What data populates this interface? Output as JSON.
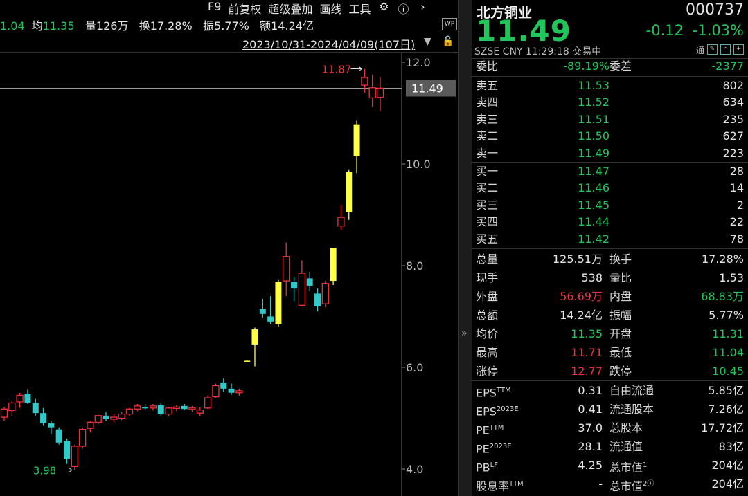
{
  "toolbar": {
    "f9": "F9",
    "adjust": "前复权",
    "overlay": "超级叠加",
    "draw": "画线",
    "tools": "工具",
    "settings_icon": "gear-icon",
    "help_icon": "help-icon",
    "more_icon": "chevron-right-icon"
  },
  "stats": {
    "partial_val": "1.04",
    "avg_label": "均",
    "avg_val": "11.35",
    "vol_label": "量",
    "vol_val": "126万",
    "turn_label": "换",
    "turn_val": "17.28%",
    "amp_label": "振",
    "amp_val": "5.77%",
    "amt_label": "额",
    "amt_val": "14.24亿"
  },
  "date_range": "2023/10/31-2024/04/09(107日)",
  "wp_label": "WP",
  "chart_data": {
    "type": "candlestick",
    "y_ticks": [
      "12.0",
      "10.0",
      "8.0",
      "6.0",
      "4.0"
    ],
    "y_tick_values": [
      12.0,
      10.0,
      8.0,
      6.0,
      4.0
    ],
    "ylim": [
      3.85,
      12.45
    ],
    "current_price_label": "11.49",
    "current_price": 11.49,
    "max_label": "11.87",
    "max_value": 11.87,
    "min_label": "3.98",
    "min_value": 3.98,
    "colors": {
      "up": "#f0313b",
      "down": "#32c8c8",
      "limit_up": "#ffff44"
    },
    "candles": [
      {
        "o": 5.02,
        "h": 5.22,
        "l": 4.95,
        "c": 5.18,
        "t": "up"
      },
      {
        "o": 5.15,
        "h": 5.35,
        "l": 5.05,
        "c": 5.3,
        "t": "up"
      },
      {
        "o": 5.32,
        "h": 5.5,
        "l": 5.2,
        "c": 5.45,
        "t": "up"
      },
      {
        "o": 5.48,
        "h": 5.56,
        "l": 5.28,
        "c": 5.3,
        "t": "down"
      },
      {
        "o": 5.3,
        "h": 5.38,
        "l": 5.05,
        "c": 5.1,
        "t": "down"
      },
      {
        "o": 5.1,
        "h": 5.2,
        "l": 4.85,
        "c": 4.9,
        "t": "down"
      },
      {
        "o": 4.9,
        "h": 4.95,
        "l": 4.68,
        "c": 4.82,
        "t": "down"
      },
      {
        "o": 4.78,
        "h": 4.82,
        "l": 4.48,
        "c": 4.52,
        "t": "down"
      },
      {
        "o": 4.55,
        "h": 4.6,
        "l": 4.1,
        "c": 4.2,
        "t": "down"
      },
      {
        "o": 4.05,
        "h": 4.48,
        "l": 3.98,
        "c": 4.45,
        "t": "up"
      },
      {
        "o": 4.45,
        "h": 4.82,
        "l": 4.4,
        "c": 4.78,
        "t": "up"
      },
      {
        "o": 4.8,
        "h": 4.95,
        "l": 4.72,
        "c": 4.92,
        "t": "up"
      },
      {
        "o": 4.92,
        "h": 5.08,
        "l": 4.88,
        "c": 5.05,
        "t": "up"
      },
      {
        "o": 5.05,
        "h": 5.12,
        "l": 4.95,
        "c": 4.98,
        "t": "down"
      },
      {
        "o": 4.98,
        "h": 5.08,
        "l": 4.92,
        "c": 5.02,
        "t": "up"
      },
      {
        "o": 5.0,
        "h": 5.12,
        "l": 4.96,
        "c": 5.08,
        "t": "up"
      },
      {
        "o": 5.08,
        "h": 5.2,
        "l": 5.04,
        "c": 5.18,
        "t": "up"
      },
      {
        "o": 5.18,
        "h": 5.28,
        "l": 5.14,
        "c": 5.24,
        "t": "up"
      },
      {
        "o": 5.22,
        "h": 5.28,
        "l": 5.16,
        "c": 5.2,
        "t": "down"
      },
      {
        "o": 5.2,
        "h": 5.28,
        "l": 5.15,
        "c": 5.24,
        "t": "up"
      },
      {
        "o": 5.26,
        "h": 5.3,
        "l": 5.05,
        "c": 5.08,
        "t": "down"
      },
      {
        "o": 5.08,
        "h": 5.22,
        "l": 5.04,
        "c": 5.2,
        "t": "up"
      },
      {
        "o": 5.2,
        "h": 5.26,
        "l": 5.14,
        "c": 5.22,
        "t": "up"
      },
      {
        "o": 5.24,
        "h": 5.28,
        "l": 5.16,
        "c": 5.18,
        "t": "down"
      },
      {
        "o": 5.18,
        "h": 5.24,
        "l": 5.12,
        "c": 5.2,
        "t": "up"
      },
      {
        "o": 5.1,
        "h": 5.22,
        "l": 5.04,
        "c": 5.16,
        "t": "up"
      },
      {
        "o": 5.2,
        "h": 5.45,
        "l": 5.18,
        "c": 5.4,
        "t": "up"
      },
      {
        "o": 5.42,
        "h": 5.68,
        "l": 5.4,
        "c": 5.64,
        "t": "up"
      },
      {
        "o": 5.7,
        "h": 5.78,
        "l": 5.52,
        "c": 5.58,
        "t": "down"
      },
      {
        "o": 5.58,
        "h": 5.68,
        "l": 5.46,
        "c": 5.5,
        "t": "down"
      },
      {
        "o": 5.5,
        "h": 5.58,
        "l": 5.44,
        "c": 5.54,
        "t": "up"
      },
      {
        "o": 6.12,
        "h": 6.14,
        "l": 6.1,
        "c": 6.13,
        "t": "limit"
      },
      {
        "o": 6.45,
        "h": 6.78,
        "l": 6.02,
        "c": 6.75,
        "t": "limit"
      },
      {
        "o": 7.15,
        "h": 7.35,
        "l": 6.98,
        "c": 7.05,
        "t": "down"
      },
      {
        "o": 7.0,
        "h": 7.4,
        "l": 6.85,
        "c": 6.9,
        "t": "down"
      },
      {
        "o": 6.85,
        "h": 7.72,
        "l": 6.8,
        "c": 7.68,
        "t": "limit"
      },
      {
        "o": 7.7,
        "h": 8.45,
        "l": 7.4,
        "c": 8.18,
        "t": "up"
      },
      {
        "o": 7.68,
        "h": 7.78,
        "l": 7.3,
        "c": 7.55,
        "t": "down"
      },
      {
        "o": 7.22,
        "h": 8.1,
        "l": 7.2,
        "c": 7.85,
        "t": "up"
      },
      {
        "o": 7.75,
        "h": 7.88,
        "l": 7.5,
        "c": 7.6,
        "t": "down"
      },
      {
        "o": 7.45,
        "h": 7.55,
        "l": 7.1,
        "c": 7.2,
        "t": "down"
      },
      {
        "o": 7.25,
        "h": 7.7,
        "l": 7.18,
        "c": 7.65,
        "t": "up"
      },
      {
        "o": 7.7,
        "h": 8.35,
        "l": 7.62,
        "c": 8.35,
        "t": "limit"
      },
      {
        "o": 8.78,
        "h": 9.2,
        "l": 8.7,
        "c": 8.95,
        "t": "up"
      },
      {
        "o": 9.05,
        "h": 9.88,
        "l": 8.9,
        "c": 9.85,
        "t": "limit"
      },
      {
        "o": 10.15,
        "h": 10.85,
        "l": 9.82,
        "c": 10.78,
        "t": "limit"
      },
      {
        "o": 11.7,
        "h": 11.87,
        "l": 11.4,
        "c": 11.55,
        "t": "up"
      },
      {
        "o": 11.5,
        "h": 11.75,
        "l": 11.12,
        "c": 11.3,
        "t": "up"
      },
      {
        "o": 11.31,
        "h": 11.71,
        "l": 11.04,
        "c": 11.49,
        "t": "up"
      }
    ]
  },
  "quote": {
    "name": "北方铜业",
    "code": "000737",
    "price": "11.49",
    "change": "-0.12",
    "change_pct": "-1.03%",
    "exchange": "SZSE",
    "currency": "CNY",
    "time": "11:29:18",
    "status": "交易中",
    "tong": "通",
    "ratio_label": "委比",
    "ratio_val": "-89.19%",
    "diff_label": "委差",
    "diff_val": "-2377",
    "asks": [
      {
        "label": "卖五",
        "price": "11.53",
        "vol": "802"
      },
      {
        "label": "卖四",
        "price": "11.52",
        "vol": "634"
      },
      {
        "label": "卖三",
        "price": "11.51",
        "vol": "235"
      },
      {
        "label": "卖二",
        "price": "11.50",
        "vol": "627"
      },
      {
        "label": "卖一",
        "price": "11.49",
        "vol": "223"
      }
    ],
    "bids": [
      {
        "label": "买一",
        "price": "11.47",
        "vol": "28"
      },
      {
        "label": "买二",
        "price": "11.46",
        "vol": "14"
      },
      {
        "label": "买三",
        "price": "11.45",
        "vol": "2"
      },
      {
        "label": "买四",
        "price": "11.44",
        "vol": "22"
      },
      {
        "label": "买五",
        "price": "11.42",
        "vol": "78"
      }
    ],
    "stats": [
      {
        "k1": "总量",
        "v1": "125.51万",
        "c1": "wht",
        "k2": "换手",
        "v2": "17.28%",
        "c2": "wht"
      },
      {
        "k1": "现手",
        "v1": "538",
        "c1": "wht",
        "k2": "量比",
        "v2": "1.53",
        "c2": "wht"
      },
      {
        "k1": "外盘",
        "v1": "56.69万",
        "c1": "red",
        "k2": "内盘",
        "v2": "68.83万",
        "c2": "grn"
      },
      {
        "k1": "总额",
        "v1": "14.24亿",
        "c1": "wht",
        "k2": "振幅",
        "v2": "5.77%",
        "c2": "wht"
      },
      {
        "k1": "均价",
        "v1": "11.35",
        "c1": "grn",
        "k2": "开盘",
        "v2": "11.31",
        "c2": "grn"
      },
      {
        "k1": "最高",
        "v1": "11.71",
        "c1": "red",
        "k2": "最低",
        "v2": "11.04",
        "c2": "grn"
      },
      {
        "k1": "涨停",
        "v1": "12.77",
        "c1": "red",
        "k2": "跌停",
        "v2": "10.45",
        "c2": "grn"
      }
    ],
    "fundamentals": [
      {
        "k1": "EPS",
        "s1": "TTM",
        "v1": "0.31",
        "k2": "自由流通",
        "s2": "",
        "v2": "5.85亿"
      },
      {
        "k1": "EPS",
        "s1": "2023E",
        "v1": "0.41",
        "k2": "流通股本",
        "s2": "",
        "v2": "7.26亿"
      },
      {
        "k1": "PE",
        "s1": "TTM",
        "v1": "37.0",
        "k2": "总股本",
        "s2": "",
        "v2": "17.72亿"
      },
      {
        "k1": "PE",
        "s1": "2023E",
        "v1": "28.1",
        "k2": "流通值",
        "s2": "",
        "v2": "83亿"
      },
      {
        "k1": "PB",
        "s1": "LF",
        "v1": "4.25",
        "k2": "总市值",
        "s2": "1",
        "v2": "204亿"
      },
      {
        "k1": "股息率",
        "s1": "TTM",
        "v1": "-",
        "k2": "总市值",
        "s2": "2ⓘ",
        "v2": "204亿"
      }
    ]
  }
}
